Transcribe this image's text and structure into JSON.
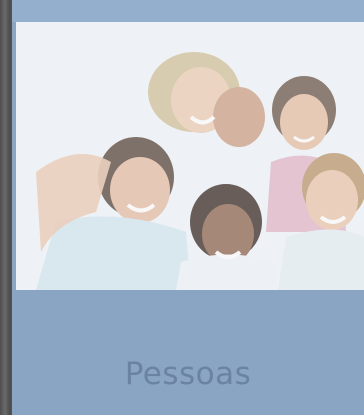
{
  "caption": {
    "text": "Pessoas"
  },
  "photo": {
    "subject": "group-of-smiling-young-people"
  },
  "colors": {
    "panel": "#8aa5c4",
    "caption_text": "#6b83a0",
    "frame": "#5d5d5d",
    "photo_bg": "#e6ecf1"
  }
}
